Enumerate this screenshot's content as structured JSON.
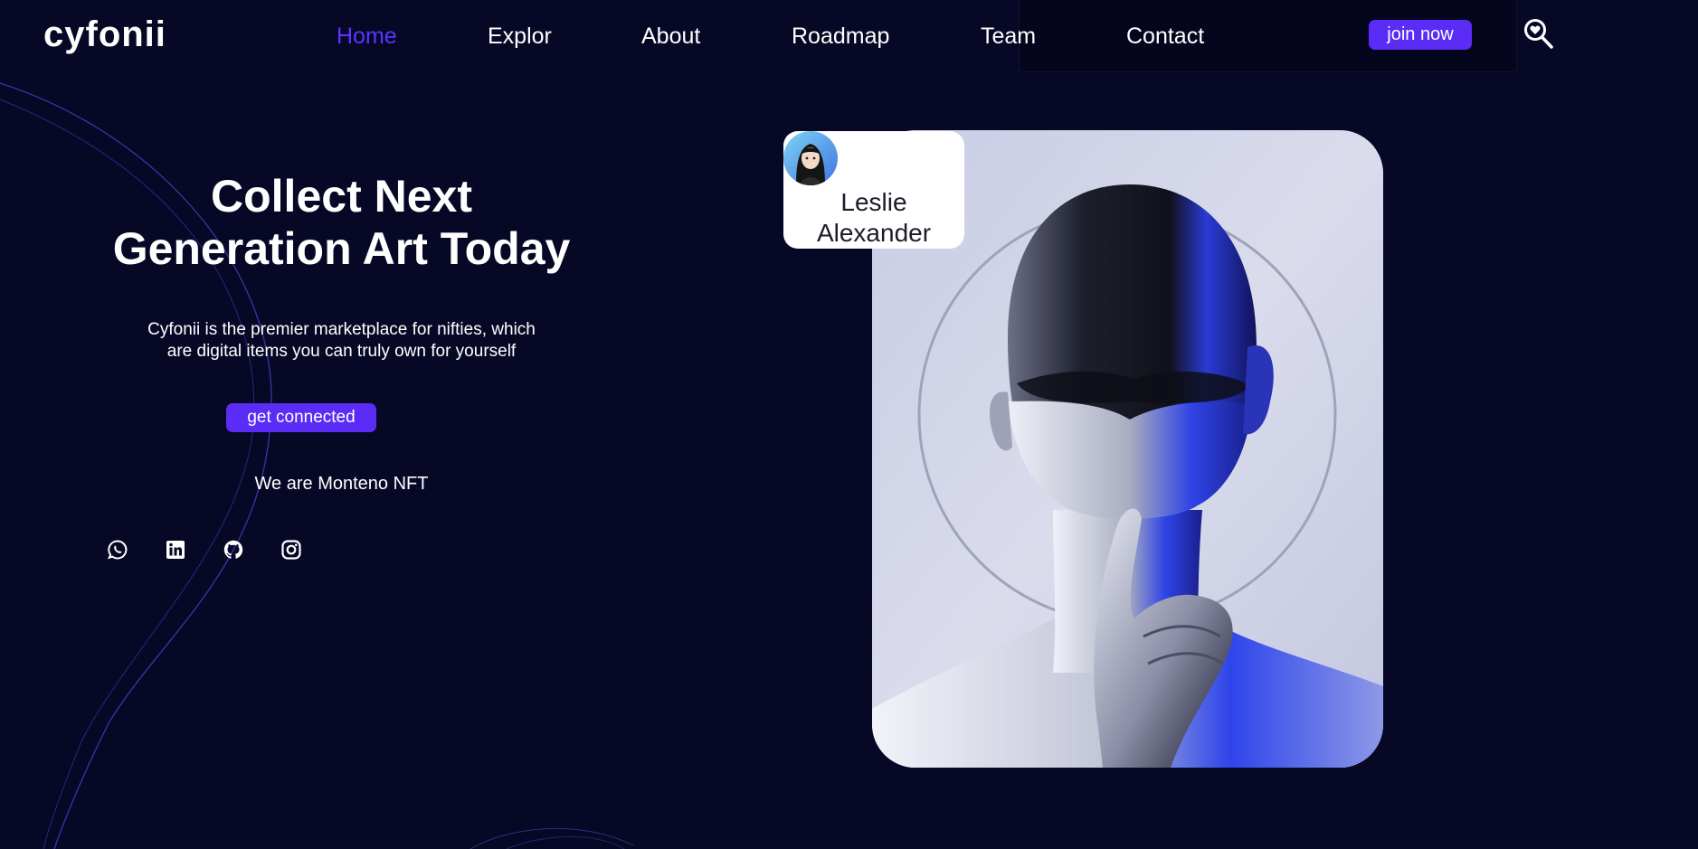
{
  "header": {
    "logo_text": "cyfonii",
    "nav": [
      {
        "label": "Home",
        "active": true
      },
      {
        "label": "Explor",
        "active": false
      },
      {
        "label": "About",
        "active": false
      },
      {
        "label": "Roadmap",
        "active": false
      },
      {
        "label": "Team",
        "active": false
      },
      {
        "label": "Contact",
        "active": false
      }
    ],
    "join_label": "join now",
    "search_icon": "search-heart-icon"
  },
  "hero": {
    "title_line1": "Collect Next",
    "title_line2": "Generation Art Today",
    "description_line1": "Cyfonii is the premier marketplace for nifties, which",
    "description_line2": "are digital items you can truly own for yourself",
    "cta_label": "get connected",
    "tagline": "We are Monteno NFT",
    "socials": [
      "whatsapp-icon",
      "linkedin-icon",
      "github-icon",
      "instagram-icon"
    ]
  },
  "artwork": {
    "profile_name_line1": "Leslie",
    "profile_name_line2": "Alexander"
  },
  "colors": {
    "background": "#070826",
    "accent": "#5b2cf5",
    "active_nav": "#5b35ff",
    "text": "#ffffff"
  }
}
